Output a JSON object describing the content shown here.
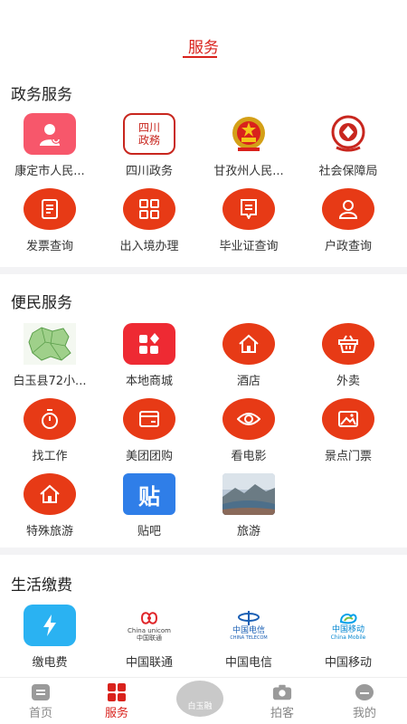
{
  "header": {
    "title": "服务"
  },
  "sections": [
    {
      "title": "政务服务",
      "items": [
        {
          "label": "康定市人民...",
          "icon": "party-badge-icon"
        },
        {
          "label": "四川政务",
          "icon": "sichuan-seal-icon"
        },
        {
          "label": "甘孜州人民...",
          "icon": "national-emblem-icon"
        },
        {
          "label": "社会保障局",
          "icon": "social-security-emblem-icon"
        },
        {
          "label": "发票查询",
          "icon": "document-icon"
        },
        {
          "label": "出入境办理",
          "icon": "grid-icon"
        },
        {
          "label": "毕业证查询",
          "icon": "certificate-icon"
        },
        {
          "label": "户政查询",
          "icon": "user-icon"
        }
      ]
    },
    {
      "title": "便民服务",
      "items": [
        {
          "label": "白玉县72小...",
          "icon": "county-map-icon"
        },
        {
          "label": "本地商城",
          "icon": "shop-grid-icon"
        },
        {
          "label": "酒店",
          "icon": "home-icon"
        },
        {
          "label": "外卖",
          "icon": "basket-icon"
        },
        {
          "label": "找工作",
          "icon": "stopwatch-icon"
        },
        {
          "label": "美团团购",
          "icon": "card-icon"
        },
        {
          "label": "看电影",
          "icon": "eye-icon"
        },
        {
          "label": "景点门票",
          "icon": "picture-icon"
        },
        {
          "label": "特殊旅游",
          "icon": "home-icon"
        },
        {
          "label": "贴吧",
          "icon": "tieba-icon"
        },
        {
          "label": "旅游",
          "icon": "landscape-photo-icon"
        }
      ]
    },
    {
      "title": "生活缴费",
      "items": [
        {
          "label": "缴电费",
          "icon": "lightning-icon"
        },
        {
          "label": "中国联通",
          "icon": "china-unicom-logo-icon"
        },
        {
          "label": "中国电信",
          "icon": "china-telecom-logo-icon"
        },
        {
          "label": "中国移动",
          "icon": "china-mobile-logo-icon"
        }
      ]
    }
  ],
  "logos": {
    "sichuan": "四川政務",
    "unicom_cn": "中国联通",
    "unicom_en": "China unicom",
    "telecom_cn": "中国电信",
    "telecom_en": "CHINA TELECOM",
    "mobile_cn": "中国移动",
    "mobile_en": "China Mobile",
    "tieba": "贴"
  },
  "bottom_nav": {
    "items": [
      {
        "label": "首页",
        "icon": "home-doc-icon"
      },
      {
        "label": "服务",
        "icon": "grid-icon",
        "active": true
      },
      {
        "label": "拍客",
        "icon": "camera-icon"
      },
      {
        "label": "我的",
        "icon": "profile-icon"
      }
    ],
    "center_badge": "白玉融"
  },
  "colors": {
    "accent": "#d9221c",
    "icon_orange": "#e73a16",
    "divider": "#f3f3f5"
  }
}
